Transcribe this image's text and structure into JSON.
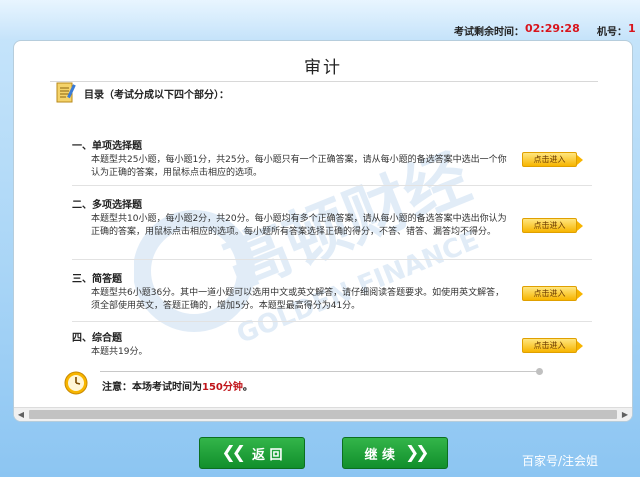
{
  "header": {
    "timer_label": "考试剩余时间：",
    "timer_value": "02:29:28",
    "machine_label": "机号：",
    "machine_value": "1"
  },
  "page": {
    "title": "审计",
    "toc_heading": "目录（考试分成以下四个部分）："
  },
  "sections": [
    {
      "title": "一、单项选择题",
      "desc": "本题型共25小题，每小题1分，共25分。每小题只有一个正确答案，请从每小题的备选答案中选出一个你认为正确的答案，用鼠标点击相应的选项。",
      "button": "点击进入"
    },
    {
      "title": "二、多项选择题",
      "desc": "本题型共10小题，每小题2分，共20分。每小题均有多个正确答案，请从每小题的备选答案中选出你认为正确的答案，用鼠标点击相应的选项。每小题所有答案选择正确的得分，不答、错答、漏答均不得分。",
      "button": "点击进入"
    },
    {
      "title": "三、简答题",
      "desc": "本题型共6小题36分。其中一道小题可以选用中文或英文解答，请仔细阅读答题要求。如使用英文解答，须全部使用英文，答题正确的，增加5分。本题型最高得分为41分。",
      "button": "点击进入"
    },
    {
      "title": "四、综合题",
      "desc": "本题共19分。",
      "button": "点击进入"
    }
  ],
  "notice": {
    "prefix": "注意：本场考试时间为",
    "highlight": "150分钟",
    "suffix": "。"
  },
  "nav": {
    "back_label": "返 回",
    "continue_label": "继 续"
  },
  "watermark": {
    "cn": "高顿财经",
    "en": "GOLDEN FINANCE"
  },
  "footer": {
    "mark": "百家号/注会姐"
  },
  "colors": {
    "accent_red": "#c0141a",
    "button_green": "#118f2c",
    "enter_yellow": "#f7b500"
  }
}
